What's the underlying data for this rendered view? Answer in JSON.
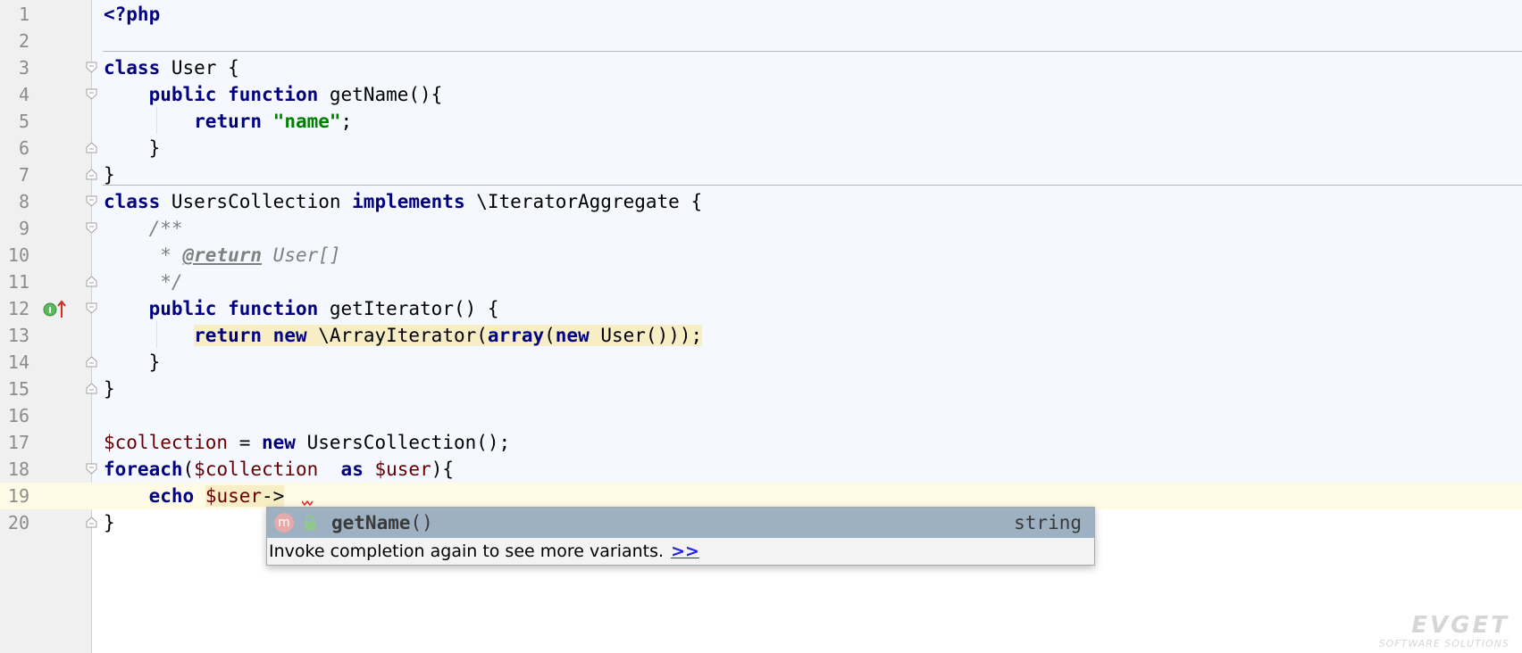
{
  "editor": {
    "language": "php",
    "lines": [
      {
        "n": "1",
        "tokens": [
          {
            "t": "<?php",
            "c": "kw"
          }
        ]
      },
      {
        "n": "2",
        "tokens": []
      },
      {
        "n": "3",
        "tokens": [
          {
            "t": "class",
            "c": "kw"
          },
          {
            "t": " User {",
            "c": ""
          }
        ]
      },
      {
        "n": "4",
        "tokens": [
          {
            "t": "    ",
            "c": ""
          },
          {
            "t": "public",
            "c": "kw"
          },
          {
            "t": " ",
            "c": ""
          },
          {
            "t": "function",
            "c": "kw"
          },
          {
            "t": " getName(){",
            "c": ""
          }
        ]
      },
      {
        "n": "5",
        "tokens": [
          {
            "t": "        ",
            "c": ""
          },
          {
            "t": "return",
            "c": "kw"
          },
          {
            "t": " ",
            "c": ""
          },
          {
            "t": "\"name\"",
            "c": "str"
          },
          {
            "t": ";",
            "c": ""
          }
        ]
      },
      {
        "n": "6",
        "tokens": [
          {
            "t": "    }",
            "c": ""
          }
        ]
      },
      {
        "n": "7",
        "tokens": [
          {
            "t": "}",
            "c": ""
          }
        ]
      },
      {
        "n": "8",
        "tokens": [
          {
            "t": "class",
            "c": "kw"
          },
          {
            "t": " UsersCollection ",
            "c": ""
          },
          {
            "t": "implements",
            "c": "kw"
          },
          {
            "t": " \\IteratorAggregate {",
            "c": ""
          }
        ]
      },
      {
        "n": "9",
        "tokens": [
          {
            "t": "    /**",
            "c": "cmt"
          }
        ]
      },
      {
        "n": "10",
        "tokens": [
          {
            "t": "     * ",
            "c": "cmt"
          },
          {
            "t": "@return",
            "c": "doctag"
          },
          {
            "t": " User[]",
            "c": "cmt"
          }
        ]
      },
      {
        "n": "11",
        "tokens": [
          {
            "t": "     */",
            "c": "cmt"
          }
        ]
      },
      {
        "n": "12",
        "tokens": [
          {
            "t": "    ",
            "c": ""
          },
          {
            "t": "public",
            "c": "kw"
          },
          {
            "t": " ",
            "c": ""
          },
          {
            "t": "function",
            "c": "kw"
          },
          {
            "t": " getIterator() {",
            "c": ""
          }
        ]
      },
      {
        "n": "13",
        "tokens": [
          {
            "t": "        ",
            "c": ""
          },
          {
            "t": "return",
            "c": "kw hl"
          },
          {
            "t": " ",
            "c": "hl"
          },
          {
            "t": "new",
            "c": "kw hl"
          },
          {
            "t": " \\ArrayIterator(",
            "c": "hl"
          },
          {
            "t": "array",
            "c": "kw hl"
          },
          {
            "t": "(",
            "c": "hl"
          },
          {
            "t": "new",
            "c": "kw hl"
          },
          {
            "t": " User()));",
            "c": "hl"
          }
        ]
      },
      {
        "n": "14",
        "tokens": [
          {
            "t": "    }",
            "c": ""
          }
        ]
      },
      {
        "n": "15",
        "tokens": [
          {
            "t": "}",
            "c": ""
          }
        ]
      },
      {
        "n": "16",
        "tokens": []
      },
      {
        "n": "17",
        "tokens": [
          {
            "t": "$collection",
            "c": "var"
          },
          {
            "t": " = ",
            "c": ""
          },
          {
            "t": "new",
            "c": "kw"
          },
          {
            "t": " UsersCollection();",
            "c": ""
          }
        ]
      },
      {
        "n": "18",
        "tokens": [
          {
            "t": "foreach",
            "c": "kw"
          },
          {
            "t": "(",
            "c": ""
          },
          {
            "t": "$collection",
            "c": "var"
          },
          {
            "t": "  ",
            "c": ""
          },
          {
            "t": "as",
            "c": "kw"
          },
          {
            "t": " ",
            "c": ""
          },
          {
            "t": "$user",
            "c": "var"
          },
          {
            "t": "){",
            "c": ""
          }
        ]
      },
      {
        "n": "19",
        "tokens": [
          {
            "t": "    ",
            "c": ""
          },
          {
            "t": "echo",
            "c": "kw"
          },
          {
            "t": " ",
            "c": ""
          },
          {
            "t": "$user",
            "c": "var hl"
          },
          {
            "t": "->",
            "c": "hl"
          }
        ]
      },
      {
        "n": "20",
        "tokens": [
          {
            "t": "}",
            "c": ""
          }
        ]
      }
    ]
  },
  "completion_popup": {
    "item_kind_badge": "m",
    "item_name": "getName",
    "item_params": "()",
    "item_type": "string",
    "hint_text": "Invoke completion again to see more variants.",
    "hint_link": ">>"
  },
  "watermark": {
    "brand": "EVGET",
    "tagline": "SOFTWARE SOLUTIONS"
  },
  "icons": {
    "gutter_line_12": "implements-method-icon",
    "fold_markers": "fold-toggle-icon",
    "popup_visibility": "lock-icon"
  },
  "colors": {
    "keyword": "#000080",
    "variable": "#660000",
    "string": "#008000",
    "comment": "#808080",
    "highlight": "#f8eec5",
    "current_line": "#fdfbe6",
    "popup_selected": "#9eb1c2"
  }
}
